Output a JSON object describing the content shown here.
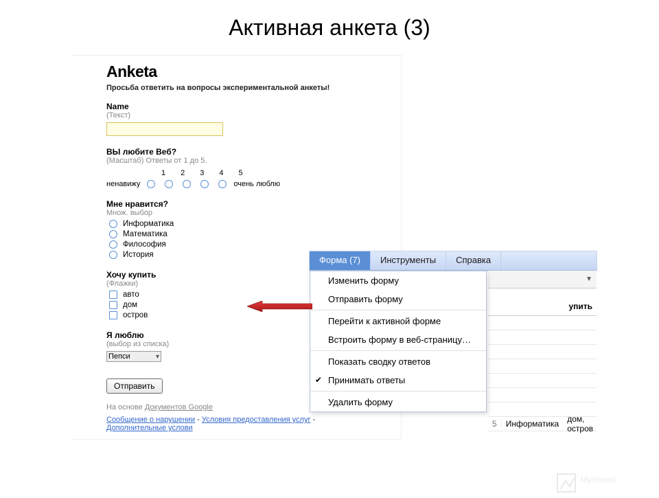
{
  "slide_title": "Активная анкета (3)",
  "form": {
    "title": "Anketa",
    "subtitle": "Просьба ответить на вопросы экспериментальной анкеты!",
    "q1": {
      "label": "Name",
      "hint": "(Текст)"
    },
    "q2": {
      "label": "ВЫ любите Веб?",
      "hint": "(Масштаб) Ответы от 1 до 5.",
      "left": "ненавижу",
      "right": "очень люблю",
      "scale": [
        "1",
        "2",
        "3",
        "4",
        "5"
      ]
    },
    "q3": {
      "label": "Мне нравится?",
      "hint": "Множ. выбор",
      "options": [
        "Информатика",
        "Математика",
        "Философия",
        "История"
      ]
    },
    "q4": {
      "label": "Хочу купить",
      "hint": "(Флажки)",
      "options": [
        "авто",
        "дом",
        "остров"
      ]
    },
    "q5": {
      "label": "Я люблю",
      "hint": "(выбор из списка)",
      "selected": "Пепси"
    },
    "submit": "Отправить",
    "footer_prefix": "На основе ",
    "footer_link": "Документов Google",
    "links": {
      "a": "Сообщение о нарушении",
      "b": "Условия предоставления услуг",
      "c": "Дополнительные услови"
    }
  },
  "menu": {
    "items": [
      "Форма (7)",
      "Инструменты",
      "Справка"
    ],
    "dropdown": [
      "Изменить форму",
      "Отправить форму",
      "Перейти к активной форме",
      "Встроить форму в веб-страницу…",
      "Показать сводку ответов",
      "Принимать ответы",
      "Удалить форму"
    ],
    "checked_index": 5
  },
  "table": {
    "col_right": "упить",
    "row": {
      "num": "5",
      "b": "Информатика",
      "c": "дом, остров"
    }
  }
}
